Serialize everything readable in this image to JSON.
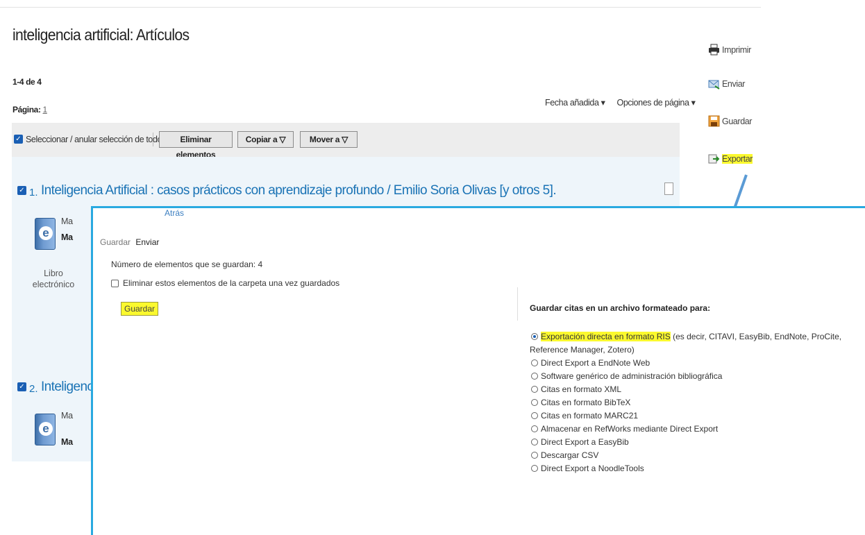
{
  "page": {
    "title": "inteligencia artificial: Artículos",
    "count": "1-4 de 4",
    "page_label": "Página:",
    "page_number": "1"
  },
  "sort": {
    "date_added": "Fecha añadida ▾",
    "page_options": "Opciones de página ▾"
  },
  "toolbar": {
    "select_all": "Seleccionar / anular selección de todo",
    "remove": "Eliminar elementos",
    "copy_to": "Copiar a ▽",
    "move_to": "Mover a ▽"
  },
  "results": [
    {
      "number": "1.",
      "title": "Inteligencia Artificial : casos prácticos con aprendizaje profundo / Emilio Soria Olivas [y otros 5].",
      "meta_1": "Ma",
      "meta_2": "Ma",
      "format": "Libro electrónico"
    },
    {
      "number": "2.",
      "title": "Inteligencia",
      "meta_1": "Ma",
      "meta_2": "Ma"
    }
  ],
  "sidebar": {
    "print": "Imprimir",
    "send": "Enviar",
    "save": "Guardar",
    "export": "Exportar"
  },
  "overlay": {
    "back": "Atrás",
    "tab_save": "Guardar",
    "tab_send": "Enviar",
    "count_text": "Número de elementos que se guardan: 4",
    "delete_text": "Eliminar estos elementos de la carpeta una vez guardados",
    "save_button": "Guardar",
    "heading": "Guardar citas en un archivo formateado para:",
    "options": [
      {
        "label_highlight": "Exportación directa en formato RIS",
        "label_rest": " (es decir, CITAVI, EasyBib, EndNote, ProCite, Reference Manager, Zotero)",
        "selected": true
      },
      {
        "label": "Direct Export a EndNote Web",
        "selected": false
      },
      {
        "label": "Software genérico de administración bibliográfica",
        "selected": false
      },
      {
        "label": "Citas en formato XML",
        "selected": false
      },
      {
        "label": "Citas en formato BibTeX",
        "selected": false
      },
      {
        "label": "Citas en formato MARC21",
        "selected": false
      },
      {
        "label": "Almacenar en RefWorks mediante Direct Export",
        "selected": false
      },
      {
        "label": "Direct Export a EasyBib",
        "selected": false
      },
      {
        "label": "Descargar CSV",
        "selected": false
      },
      {
        "label": "Direct Export a NoodleTools",
        "selected": false
      }
    ]
  },
  "colors": {
    "link_blue": "#1a73b5",
    "highlight_yellow": "#fbf92e",
    "overlay_border": "#29a9e0",
    "arrow_blue": "#5b9bd5"
  }
}
